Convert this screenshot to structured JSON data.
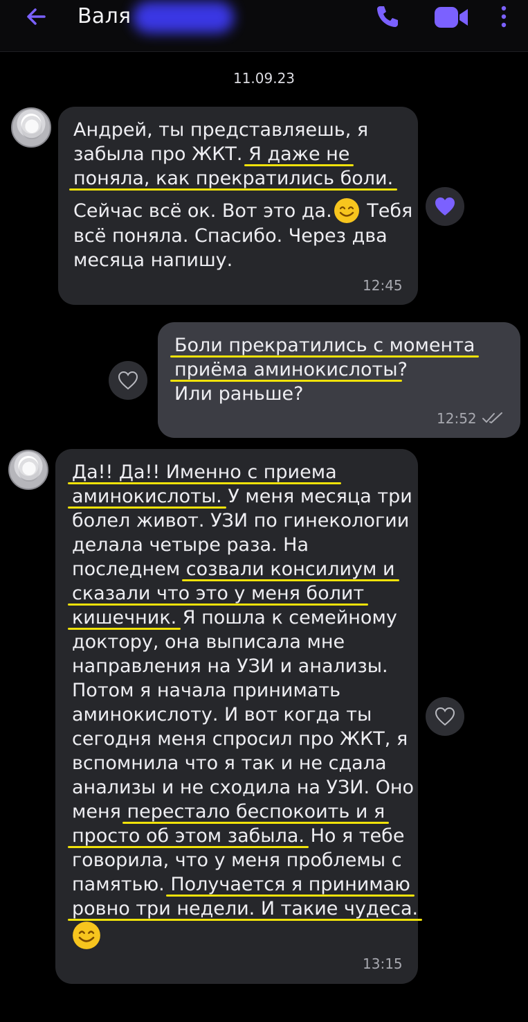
{
  "header": {
    "contact_name": "Валя",
    "icons": {
      "back": "arrow-left-icon",
      "call": "phone-icon",
      "video": "video-camera-icon",
      "menu": "more-vertical-icon"
    },
    "accent_color": "#7b61ff"
  },
  "date_separator": "11.09.23",
  "messages": [
    {
      "direction": "incoming",
      "lines_p1": [
        [
          "Андрей, ты представляешь, я",
          ""
        ],
        [
          "забыла про ЖКТ. ",
          "Я даже не"
        ],
        [
          "",
          "поняла, как прекратились боли."
        ]
      ],
      "lines_p2": [
        [
          "Сейчас всё ок. Вот это да.",
          " Тебя"
        ],
        [
          "всё поняла. Спасибо. Через два",
          ""
        ],
        [
          "месяца напишу.",
          ""
        ]
      ],
      "time": "12:45",
      "reaction": "heart-filled-icon"
    },
    {
      "direction": "outgoing",
      "lines": [
        [
          "",
          "Боли прекратились с момента"
        ],
        [
          "",
          "приёма аминокислоты",
          "?"
        ],
        [
          "Или раньше?",
          ""
        ]
      ],
      "time": "12:52",
      "status": "double-check-icon",
      "reaction": "heart-outline-icon"
    },
    {
      "direction": "incoming",
      "lines": [
        [
          "",
          "Да!! Да!! Именно с приема",
          ""
        ],
        [
          "",
          "аминокислоты.",
          " У меня месяца три"
        ],
        [
          "болел живот. УЗИ по гинекологии",
          "",
          ""
        ],
        [
          "делала четыре раза. На",
          "",
          ""
        ],
        [
          "последнем ",
          "созвали консилиум и",
          ""
        ],
        [
          "",
          "сказали что это у меня болит",
          ""
        ],
        [
          "",
          "кишечник.",
          " Я пошла к семейному"
        ],
        [
          "доктору, она выписала мне",
          "",
          ""
        ],
        [
          "направления на УЗИ и анализы.",
          "",
          ""
        ],
        [
          "Потом я начала принимать",
          "",
          ""
        ],
        [
          "аминокислоту. И вот когда ты",
          "",
          ""
        ],
        [
          "сегодня меня  спросил про ЖКТ, я",
          "",
          ""
        ],
        [
          "вспомнила что я так и не сдала",
          "",
          ""
        ],
        [
          "анализы и не сходила на УЗИ. Оно",
          "",
          ""
        ],
        [
          "меня ",
          "перестало беспокоить и я",
          ""
        ],
        [
          "",
          "просто об этом забыла.",
          " Но я тебе"
        ],
        [
          "говорила, что у меня проблемы с",
          "",
          ""
        ],
        [
          "памятью. ",
          "Получается я принимаю",
          ""
        ],
        [
          "",
          "ровно три недели. И такие чудеса.",
          ""
        ]
      ],
      "time": "13:15",
      "reaction": "heart-outline-icon"
    }
  ]
}
